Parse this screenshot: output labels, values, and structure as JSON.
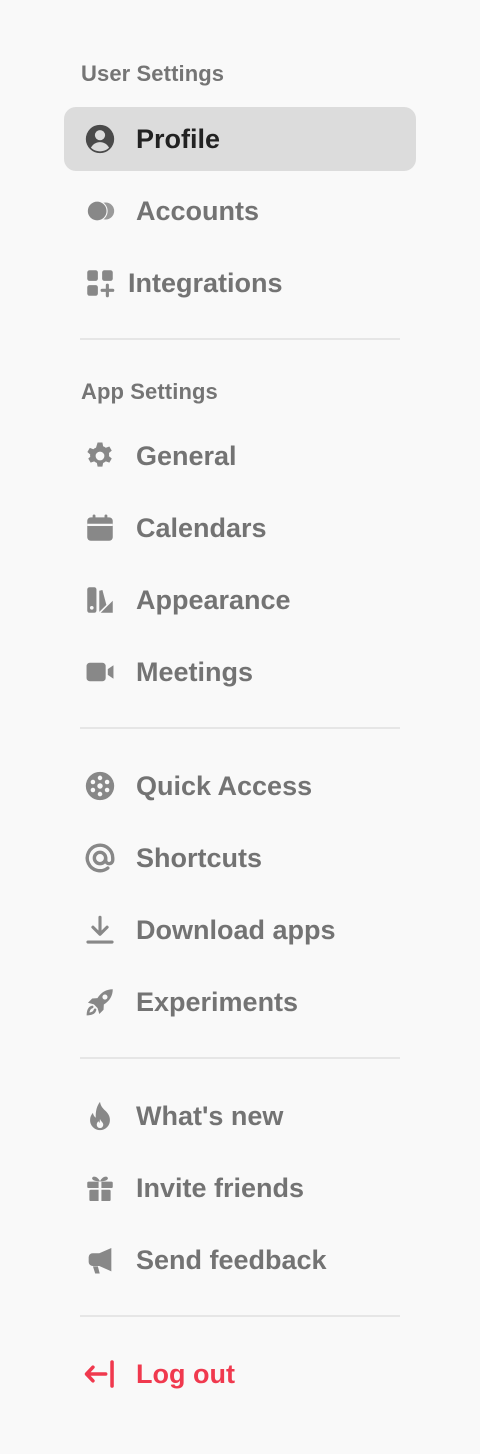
{
  "colors": {
    "background": "#f9f9f9",
    "active_background": "#dcdcdc",
    "text_muted": "#737373",
    "text_active": "#222222",
    "section_title": "#757575",
    "danger": "#f0394e",
    "icon_default": "#888888",
    "divider": "#e6e6e6"
  },
  "user_settings": {
    "title": "User Settings",
    "items": [
      {
        "label": "Profile",
        "icon": "user-circle-icon",
        "active": true
      },
      {
        "label": "Accounts",
        "icon": "toggle-icon",
        "active": false
      },
      {
        "label": "Integrations",
        "icon": "grid-plus-icon",
        "active": false
      }
    ]
  },
  "app_settings": {
    "title": "App Settings",
    "items": [
      {
        "label": "General",
        "icon": "gear-icon"
      },
      {
        "label": "Calendars",
        "icon": "calendar-icon"
      },
      {
        "label": "Appearance",
        "icon": "palette-icon"
      },
      {
        "label": "Meetings",
        "icon": "video-camera-icon"
      }
    ]
  },
  "tools": {
    "items": [
      {
        "label": "Quick Access",
        "icon": "aperture-icon"
      },
      {
        "label": "Shortcuts",
        "icon": "at-sign-icon"
      },
      {
        "label": "Download apps",
        "icon": "download-icon"
      },
      {
        "label": "Experiments",
        "icon": "rocket-icon"
      }
    ]
  },
  "community": {
    "items": [
      {
        "label": "What's new",
        "icon": "fire-icon"
      },
      {
        "label": "Invite friends",
        "icon": "gift-icon"
      },
      {
        "label": "Send feedback",
        "icon": "megaphone-icon"
      }
    ]
  },
  "logout": {
    "label": "Log out",
    "icon": "logout-arrow-icon"
  }
}
